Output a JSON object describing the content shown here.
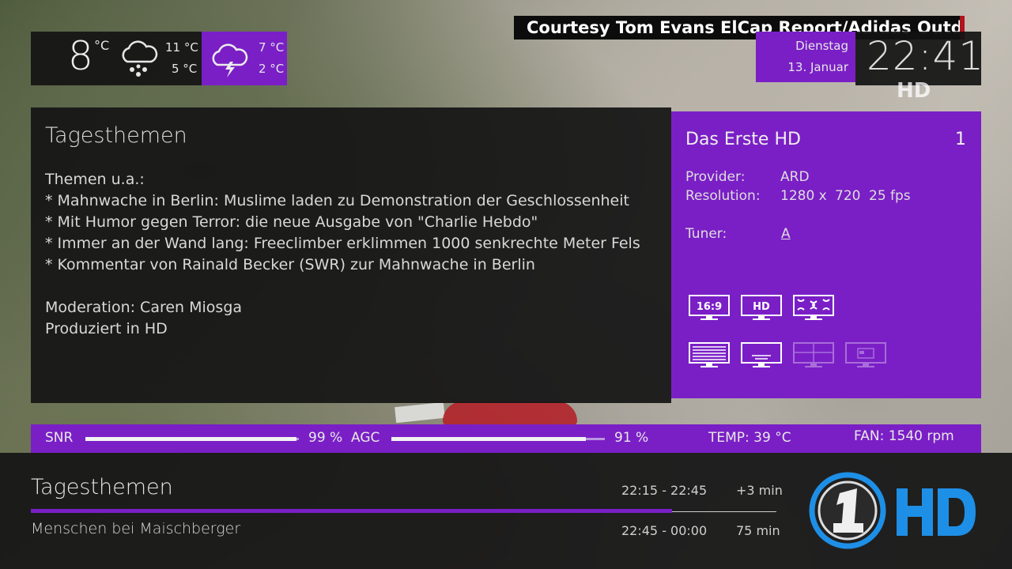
{
  "overlay": {
    "courtesy": "Courtesy Tom Evans ElCap Report/Adidas Outdoor",
    "hd_ghost": "HD"
  },
  "weather": {
    "current_temp": "8",
    "current_unit": "°C",
    "current_icon": "rain-cloud-icon",
    "today_high": "11 °C",
    "today_low": "5 °C",
    "next_icon": "thunderstorm-cloud-icon",
    "next_high": "7 °C",
    "next_low": "2 °C"
  },
  "datetime": {
    "day": "Dienstag",
    "date": "13. Januar",
    "time": "22:41"
  },
  "epg": {
    "title": "Tagesthemen",
    "lines": [
      "Themen u.a.:",
      "* Mahnwache in Berlin: Muslime laden zu Demonstration der Geschlossenheit",
      "* Mit Humor gegen Terror: die neue Ausgabe von \"Charlie Hebdo\"",
      "* Immer an der Wand lang: Freeclimber erklimmen 1000 senkrechte Meter Fels",
      "* Kommentar von Rainald Becker (SWR) zur Mahnwache in Berlin",
      "",
      "Moderation: Caren Miosga",
      "Produziert in HD"
    ]
  },
  "channel": {
    "name": "Das Erste HD",
    "number": "1",
    "provider_label": "Provider:",
    "provider": "ARD",
    "resolution_label": "Resolution:",
    "res_w": "1280 x",
    "res_h": "720",
    "fps": "25 fps",
    "tuner_label": "Tuner:",
    "tuner": "A",
    "icons": [
      {
        "name": "aspect-16-9-icon",
        "label": "16:9",
        "active": true
      },
      {
        "name": "hd-icon",
        "label": "HD",
        "active": true
      },
      {
        "name": "dolby-surround-icon",
        "active": true
      },
      {
        "name": "teletext-icon",
        "active": true
      },
      {
        "name": "subtitles-icon",
        "active": true
      },
      {
        "name": "multiview-icon",
        "active": false
      },
      {
        "name": "crypt-icon",
        "active": false
      }
    ]
  },
  "signal": {
    "snr_label": "SNR",
    "snr_value": "99 %",
    "snr": 0.99,
    "agc_label": "AGC",
    "agc_value": "91 %",
    "agc": 0.91,
    "temp": "TEMP: 39 °C",
    "fan": "FAN: 1540 rpm"
  },
  "now": {
    "title": "Tagesthemen",
    "time": "22:15 - 22:45",
    "remaining": "+3 min",
    "progress": 0.86
  },
  "next": {
    "title": "Menschen bei Maischberger",
    "time": "22:45 - 00:00",
    "duration": "75 min"
  },
  "colors": {
    "accent": "#7a1fc6",
    "logo_blue": "#1e8fe6"
  }
}
